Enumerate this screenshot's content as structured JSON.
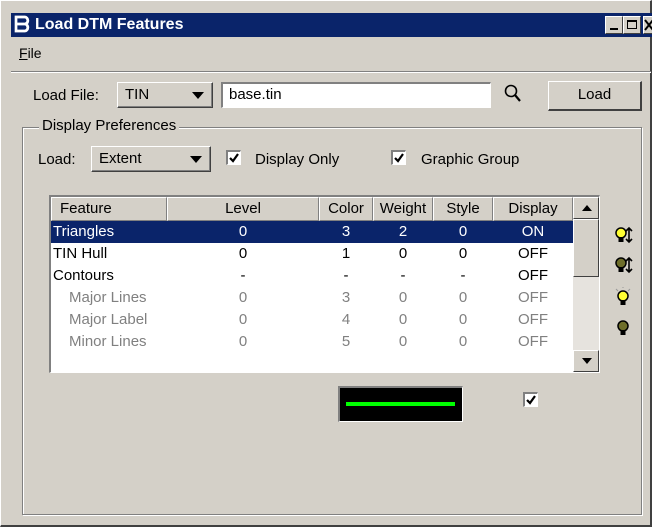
{
  "window": {
    "title": "Load DTM Features",
    "app_icon": "ᗷ"
  },
  "menu": {
    "file_first": "F",
    "file_rest": "ile"
  },
  "load_file": {
    "label": "Load File:",
    "type_value": "TIN",
    "filename": "base.tin",
    "load_button": "Load"
  },
  "display_prefs": {
    "legend": "Display Preferences",
    "load_label": "Load:",
    "load_value": "Extent",
    "display_only_label": "Display Only",
    "display_only_checked": true,
    "graphic_group_label": "Graphic Group",
    "graphic_group_checked": true
  },
  "table": {
    "headers": {
      "feature": "Feature",
      "level": "Level",
      "color": "Color",
      "weight": "Weight",
      "style": "Style",
      "display": "Display"
    },
    "rows": [
      {
        "feature": "Triangles",
        "level": "0",
        "color": "3",
        "weight": "2",
        "style": "0",
        "display": "ON",
        "selected": true,
        "disabled": false
      },
      {
        "feature": "TIN Hull",
        "level": "0",
        "color": "1",
        "weight": "0",
        "style": "0",
        "display": "OFF",
        "selected": false,
        "disabled": false
      },
      {
        "feature": "Contours",
        "level": "-",
        "color": "-",
        "weight": "-",
        "style": "-",
        "display": "OFF",
        "selected": false,
        "disabled": false
      },
      {
        "feature": "Major Lines",
        "level": "0",
        "color": "3",
        "weight": "0",
        "style": "0",
        "display": "OFF",
        "selected": false,
        "disabled": true
      },
      {
        "feature": "Major Label",
        "level": "0",
        "color": "4",
        "weight": "0",
        "style": "0",
        "display": "OFF",
        "selected": false,
        "disabled": true
      },
      {
        "feature": "Minor Lines",
        "level": "0",
        "color": "5",
        "weight": "0",
        "style": "0",
        "display": "OFF",
        "selected": false,
        "disabled": true
      }
    ]
  },
  "side_buttons": [
    {
      "icon": "bulb-on-arrows-icon"
    },
    {
      "icon": "bulb-off-arrows-icon"
    },
    {
      "icon": "bulb-on-icon"
    },
    {
      "icon": "bulb-off-icon"
    }
  ],
  "preview": {
    "line_color": "#00ff00",
    "display_checked": true
  },
  "colors": {
    "title_bar": "#0a246a",
    "dialog_face": "#d4d0c8",
    "selection": "#0a246a",
    "disabled_text": "#808080"
  }
}
